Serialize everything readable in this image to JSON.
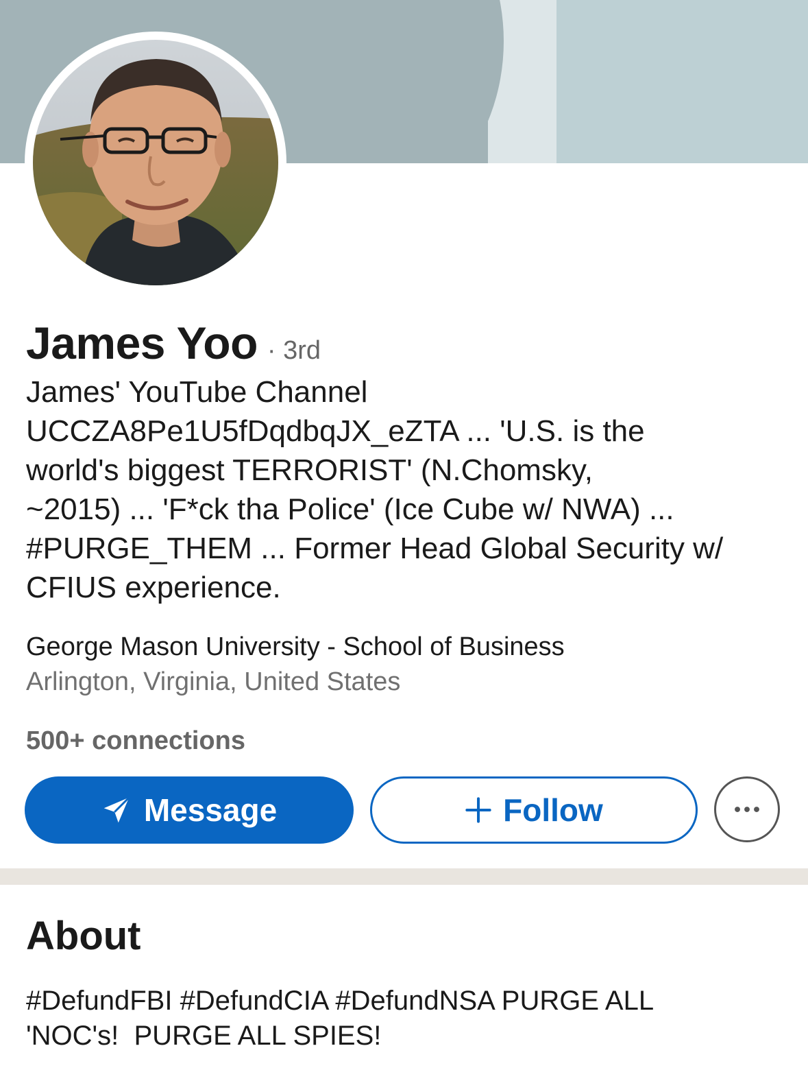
{
  "profile": {
    "name": "James Yoo",
    "degree": "· 3rd",
    "headline_lines": [
      "James' YouTube Channel",
      "UCCZA8Pe1U5fDqdbqJX_eZTA ... 'U.S. is the",
      "world's biggest TERRORIST' (N.Chomsky,",
      "~2015) ... 'F*ck tha Police' (Ice Cube w/ NWA) ...",
      "#PURGE_THEM ... Former Head Global Security w/",
      "CFIUS experience."
    ],
    "education": "George Mason University - School of Business",
    "location": "Arlington, Virginia, United States",
    "connections": "500+ connections"
  },
  "actions": {
    "message_label": "Message",
    "follow_label": "Follow",
    "message_icon": "send-icon",
    "follow_icon": "plus-icon",
    "more_icon": "more-horizontal-icon"
  },
  "about": {
    "title": "About",
    "lines": [
      "#DefundFBI #DefundCIA #DefundNSA PURGE ALL",
      "'NOC's!  PURGE ALL SPIES!"
    ]
  },
  "colors": {
    "accent": "#0a66c2",
    "banner": "#a2b3b7",
    "divider": "#e9e5df"
  }
}
